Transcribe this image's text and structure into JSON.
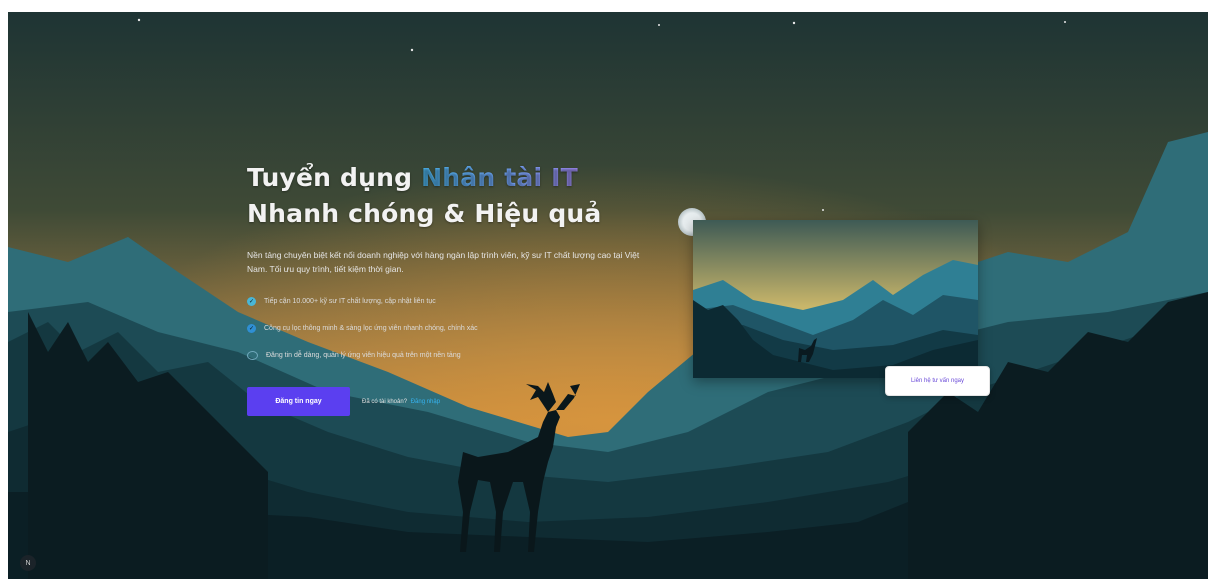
{
  "hero": {
    "title_line1_prefix": "Tuyển dụng ",
    "title_line1_accent": "Nhân tài IT",
    "title_line2": "Nhanh chóng & Hiệu quả",
    "subtitle": "Nền tảng chuyên biệt kết nối doanh nghiệp với hàng ngàn lập trình viên, kỹ sư IT chất lượng cao tại Việt Nam. Tối ưu quy trình, tiết kiệm thời gian.",
    "features": [
      {
        "icon": "check-circle-icon",
        "text": "Tiếp cận 10.000+ kỹ sư IT chất lượng, cập nhật liên tục"
      },
      {
        "icon": "shield-icon",
        "text": "Công cụ lọc thông minh & sàng lọc ứng viên nhanh chóng, chính xác"
      },
      {
        "icon": "circle-outline-icon",
        "text": "Đăng tin dễ dàng, quản lý ứng viên hiệu quả trên một nền tảng"
      }
    ],
    "cta_button": "Đăng tin ngay",
    "login_prompt": "Đã có tài khoản?",
    "login_link": "Đăng nhập"
  },
  "preview": {
    "button_label": "Liên hệ tư vấn ngay"
  },
  "corner_button_label": "N",
  "colors": {
    "accent_purple": "#5b3ff0",
    "accent_blue": "#36b3f0",
    "sky_top": "#20383a",
    "sky_glow": "#c58a3e"
  }
}
